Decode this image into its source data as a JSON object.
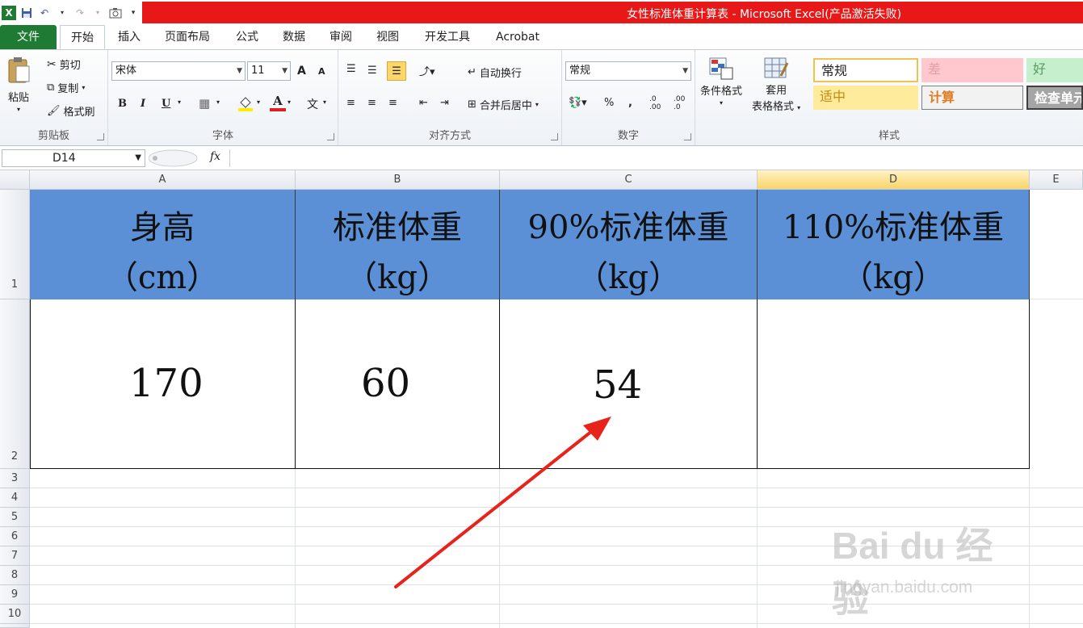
{
  "window": {
    "title": "女性标准体重计算表 - Microsoft Excel(产品激活失败)"
  },
  "tabs": [
    "文件",
    "开始",
    "插入",
    "页面布局",
    "公式",
    "数据",
    "审阅",
    "视图",
    "开发工具",
    "Acrobat"
  ],
  "clipboard": {
    "paste": "粘贴",
    "cut": "剪切",
    "copy": "复制",
    "format_painter": "格式刷",
    "label": "剪贴板"
  },
  "font": {
    "name": "宋体",
    "size": "11",
    "label": "字体",
    "bold": "B",
    "italic": "I",
    "underline": "U",
    "grow": "A",
    "shrink": "A",
    "color_letter": "A",
    "phonetic": "文"
  },
  "alignment": {
    "wrap": "自动换行",
    "merge": "合并后居中",
    "label": "对齐方式"
  },
  "number": {
    "format": "常规",
    "percent": "%",
    "comma": ",",
    "inc": ".0\n.00",
    "dec": ".00\n.0",
    "label": "数字"
  },
  "styles": {
    "cond_format": "条件格式",
    "table_format_1": "套用",
    "table_format_2": "表格格式",
    "normal": "常规",
    "bad": "差",
    "good": "好",
    "neutral": "适中",
    "calc": "计算",
    "check": "检查单元",
    "label": "样式"
  },
  "formula_bar": {
    "name_box": "D14",
    "fx": "fx",
    "content": ""
  },
  "columns": [
    "A",
    "B",
    "C",
    "D",
    "E"
  ],
  "rows": [
    "1",
    "2",
    "3",
    "4",
    "5",
    "6",
    "7",
    "8",
    "9",
    "10"
  ],
  "table": {
    "headers": [
      {
        "line1": "身高",
        "line2": "（cm）"
      },
      {
        "line1": "标准体重",
        "line2": "（kg）"
      },
      {
        "line1": "90%标准体重",
        "line2": "（kg）"
      },
      {
        "line1": "110%标准体重",
        "line2": "（kg）"
      }
    ],
    "values": [
      "170",
      "60",
      "54",
      ""
    ]
  },
  "watermark": {
    "brand": "Bai du 经验",
    "url": "jingyan.baidu.com"
  },
  "colors": {
    "header_fill": "#5b8fd6",
    "title_bar": "#e81818",
    "file_tab": "#1f7a34",
    "arrow": "#e8231c"
  }
}
